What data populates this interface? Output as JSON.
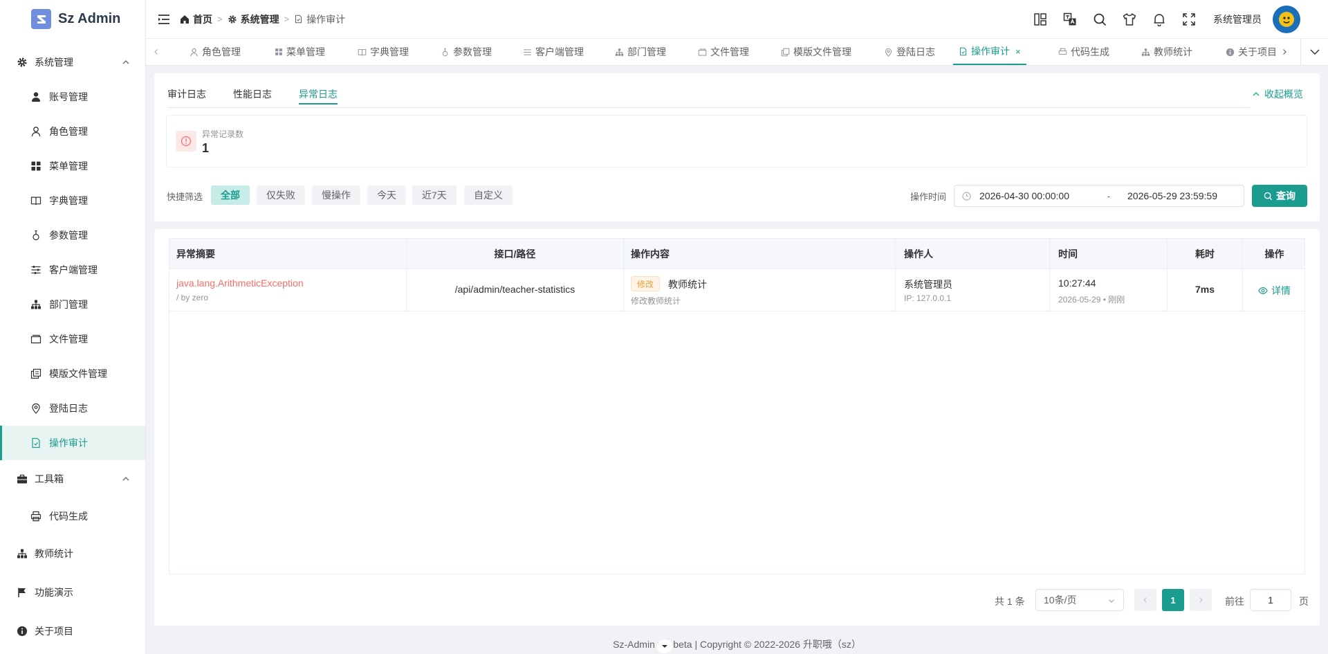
{
  "app": {
    "name": "Sz Admin"
  },
  "sidebar": {
    "groups": {
      "system": "系统管理",
      "tools": "工具箱",
      "teacher_stats": "教师统计",
      "demo": "功能演示",
      "about": "关于项目"
    },
    "system_items": [
      "账号管理",
      "角色管理",
      "菜单管理",
      "字典管理",
      "参数管理",
      "客户端管理",
      "部门管理",
      "文件管理",
      "模版文件管理",
      "登陆日志",
      "操作审计"
    ],
    "tool_items": [
      "代码生成"
    ]
  },
  "header": {
    "breadcrumb": [
      "首页",
      "系统管理",
      "操作审计"
    ],
    "user": "系统管理员"
  },
  "tabs": [
    "角色管理",
    "菜单管理",
    "字典管理",
    "参数管理",
    "客户端管理",
    "部门管理",
    "文件管理",
    "模版文件管理",
    "登陆日志",
    "操作审计",
    "代码生成",
    "教师统计",
    "关于项目"
  ],
  "subtabs": [
    "审计日志",
    "性能日志",
    "异常日志"
  ],
  "collapse_label": "收起概览",
  "stat": {
    "label": "异常记录数",
    "value": "1"
  },
  "filter": {
    "label": "快捷筛选",
    "chips": [
      "全部",
      "仅失败",
      "慢操作",
      "今天",
      "近7天",
      "自定义"
    ],
    "time_label": "操作时间",
    "start": "2026-04-30 00:00:00",
    "separator": "-",
    "end": "2026-05-29 23:59:59",
    "query": "查询"
  },
  "table": {
    "headers": [
      "异常摘要",
      "接口/路径",
      "操作内容",
      "操作人",
      "时间",
      "耗时",
      "操作"
    ],
    "rows": [
      {
        "exception": "java.lang.ArithmeticException",
        "message": "/ by zero",
        "path": "/api/admin/teacher-statistics",
        "op_tag": "修改",
        "op_title": "教师统计",
        "op_desc": "修改教师统计",
        "operator": "系统管理员",
        "ip": "IP: 127.0.0.1",
        "time": "10:27:44",
        "date": "2026-05-29 • 刚刚",
        "duration": "7ms",
        "action": "详情"
      }
    ]
  },
  "pagination": {
    "total": "共 1 条",
    "page_size": "10条/页",
    "current": "1",
    "goto_prefix": "前往",
    "goto_value": "1",
    "goto_suffix": "页"
  },
  "footer": "Sz-Admin v1.  beta | Copyright © 2022-2026 升职哦（sz）",
  "colors": {
    "accent": "#1a9c8e",
    "danger": "#f56c6c",
    "warning": "#e6a23c"
  }
}
